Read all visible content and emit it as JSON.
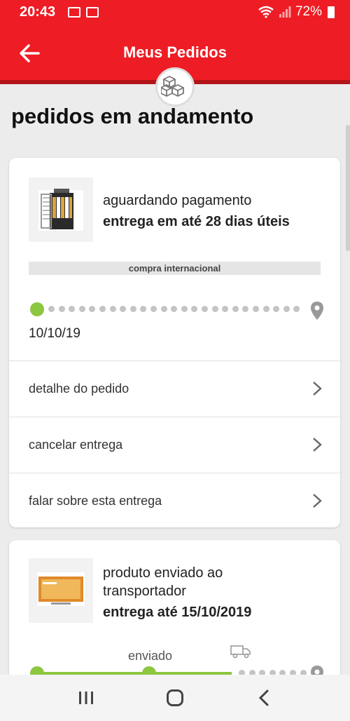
{
  "status_bar": {
    "time": "20:43",
    "battery": "72%"
  },
  "header": {
    "title": "Meus Pedidos"
  },
  "section": {
    "title": "pedidos em andamento"
  },
  "orders": [
    {
      "status": "aguardando pagamento",
      "delivery": "entrega em até 28 dias úteis",
      "badge": "compra internacional",
      "date": "10/10/19",
      "actions": [
        "detalhe do pedido",
        "cancelar entrega",
        "falar sobre esta entrega"
      ]
    },
    {
      "status_line1": "produto enviado ao",
      "status_line2": "transportador",
      "delivery": "entrega até 15/10/2019",
      "stage_label": "enviado"
    }
  ],
  "colors": {
    "brand_red": "#ee1c24",
    "progress_green": "#8dc63f",
    "pending_gray": "#c4c4c4"
  }
}
